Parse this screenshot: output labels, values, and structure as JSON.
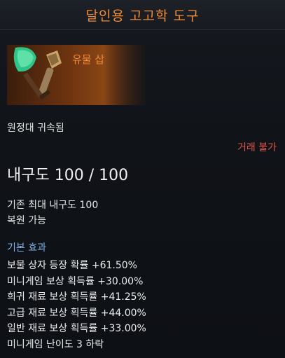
{
  "header": {
    "title": "달인용 고고학 도구"
  },
  "item": {
    "grade": "유물 삽",
    "icon": "shovel-and-brush-icon",
    "bound": "원정대 귀속됨",
    "trade": "거래 불가",
    "durability": "내구도 100 / 100",
    "max_durability": "기존 최대 내구도 100",
    "repair": "복원 가능"
  },
  "effects": {
    "heading": "기본 효과",
    "items": [
      "보물 상자 등장 확률 +61.50%",
      "미니게임 보상 획득률 +30.00%",
      "희귀 재료 보상 획득률 +41.25%",
      "고급 재료 보상 획득률 +44.00%",
      "일반 재료 보상 획득률 +33.00%",
      "미니게임 난이도 3 하락"
    ]
  },
  "colors": {
    "title": "#f08a36",
    "trade": "#e0554a",
    "section": "#7fb2e6"
  }
}
